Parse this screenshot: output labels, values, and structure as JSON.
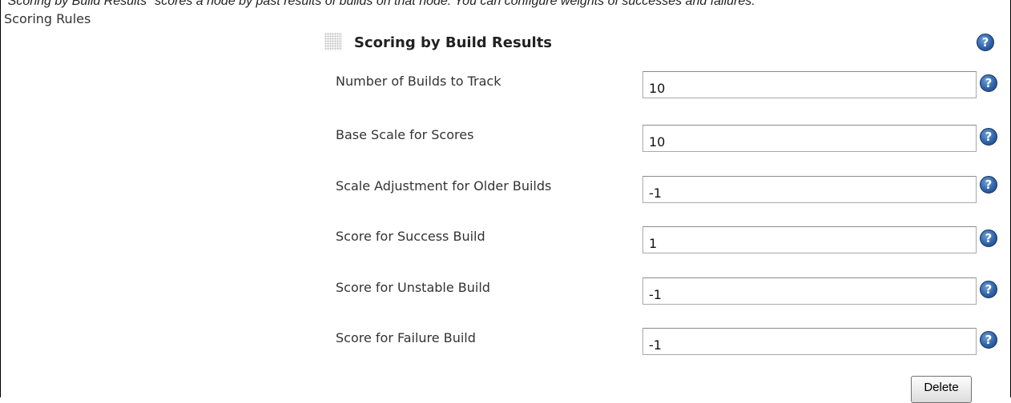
{
  "description": "\"Scoring by Build Results\" scores a node by past results of builds on that node. You can configure weights of successes and failures.",
  "section_label": "Scoring Rules",
  "descriptor": {
    "title": "Scoring by Build Results",
    "grip_icon": "drag-handle-icon",
    "help_icon": "question-mark-icon",
    "help_glyph": "?"
  },
  "fields": [
    {
      "label": "Number of Builds to Track",
      "value": "10"
    },
    {
      "label": "Base Scale for Scores",
      "value": "10"
    },
    {
      "label": "Scale Adjustment for Older Builds",
      "value": "-1"
    },
    {
      "label": "Score for Success Build",
      "value": "1"
    },
    {
      "label": "Score for Unstable Build",
      "value": "-1"
    },
    {
      "label": "Score for Failure Build",
      "value": "-1"
    }
  ],
  "delete_label": "Delete",
  "colors": {
    "help_icon": "#2f63a8",
    "text": "#333333",
    "input_border": "#a9a9a9"
  }
}
